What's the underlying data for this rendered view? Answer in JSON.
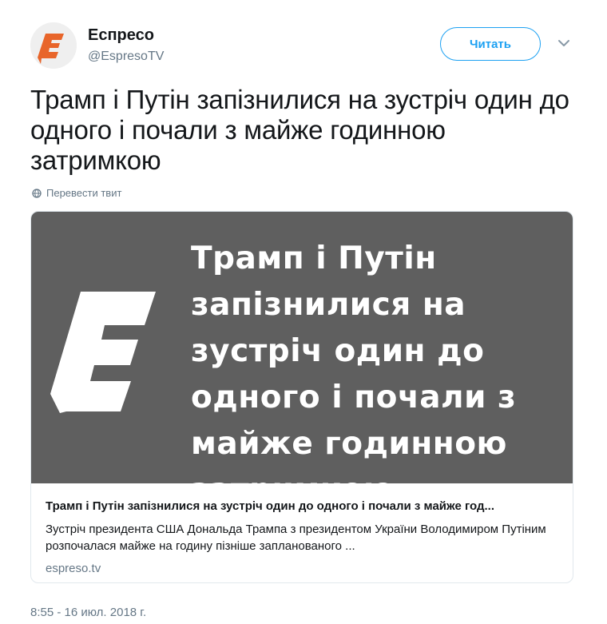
{
  "author": {
    "name": "Еспресо",
    "handle": "@EspresoTV",
    "avatar_icon": "espreso-logo-icon"
  },
  "follow_button": {
    "label": "Читать"
  },
  "menu": {
    "icon": "chevron-down-icon"
  },
  "tweet": {
    "text": "Трамп і Путін запізнилися на зустріч один до одного і почали з майже годинною затримкою",
    "translate_label": "Перевести твит",
    "translate_icon": "globe-icon",
    "timestamp": "8:55 - 16 июл. 2018 г."
  },
  "card": {
    "image_headline": "Трамп і Путін запізнилися на зустріч один до одного і почали з майже годинною затримкою",
    "image_logo": "espreso-logo-icon",
    "title": "Трамп і Путін запізнилися на зустріч один до одного і почали з майже год...",
    "description": "Зустріч президента США Дональда Трампа з президентом України Володимиром Путіним розпочалася майже на годину пізніше запланованого ...",
    "domain": "espreso.tv"
  },
  "colors": {
    "accent": "#1da1f2",
    "brand_orange": "#e8652a",
    "card_image_bg": "#5f5f5f",
    "muted_text": "#657786"
  }
}
